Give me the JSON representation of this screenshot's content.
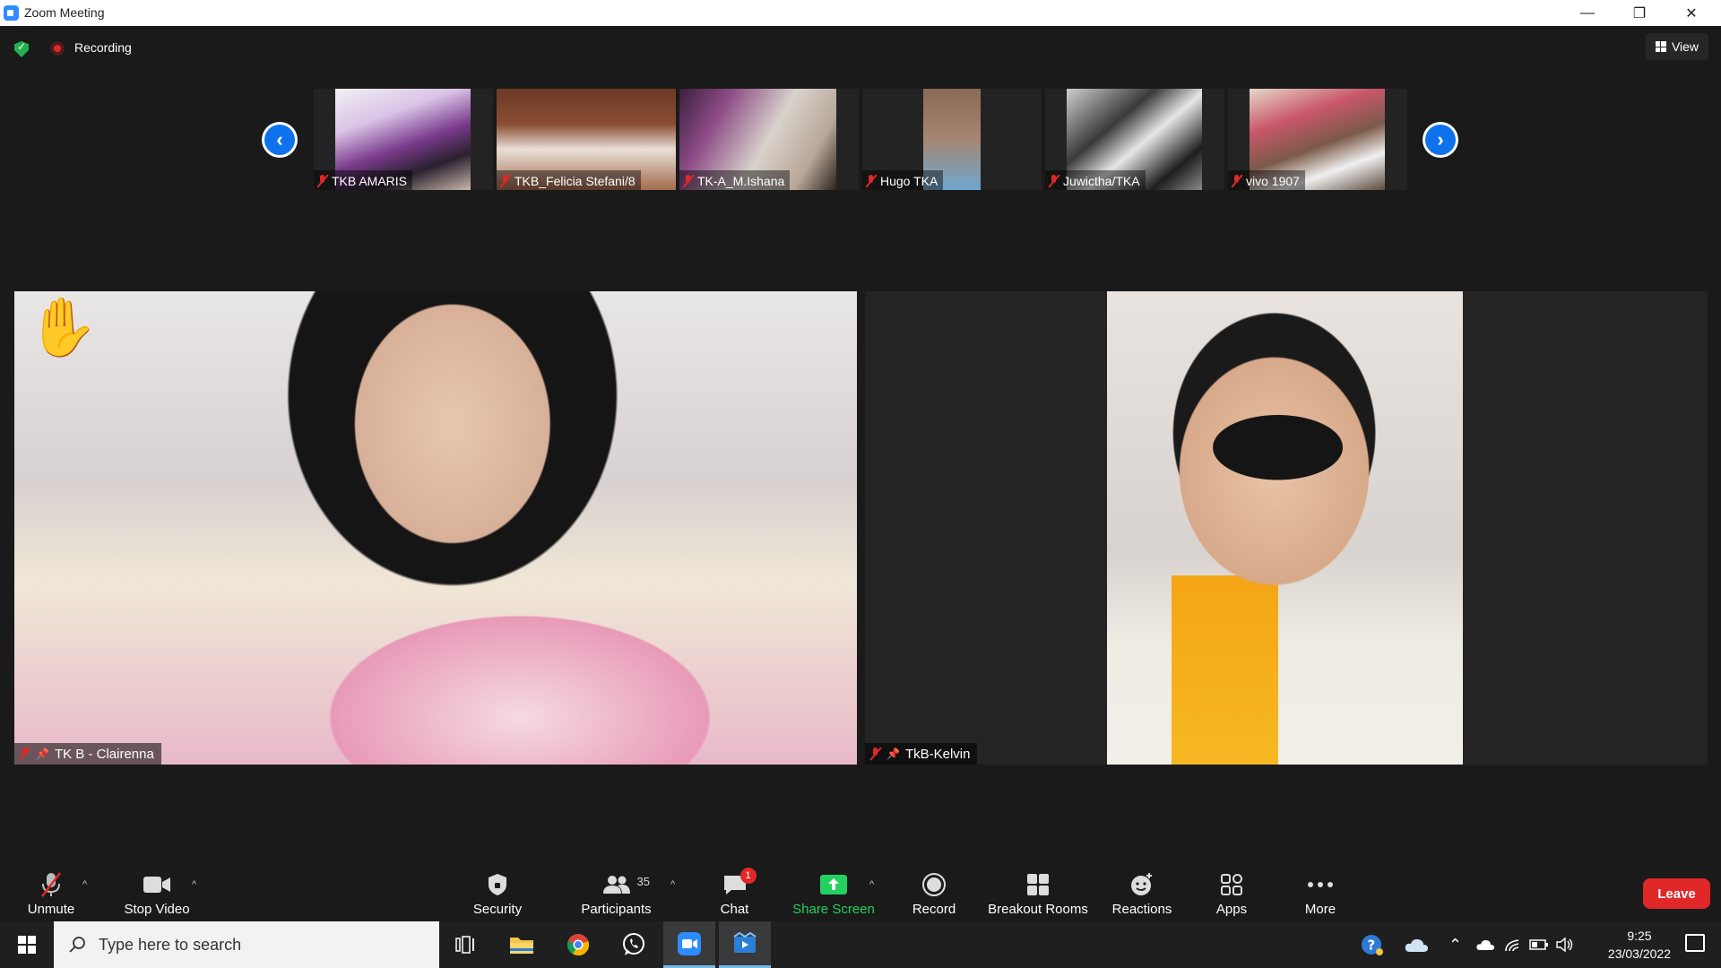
{
  "window": {
    "title": "Zoom Meeting",
    "minimize": "—",
    "restore": "❐",
    "close": "✕"
  },
  "topbar": {
    "recording_label": "Recording",
    "view_label": "View"
  },
  "thumbnails": [
    {
      "name": "TKB AMARIS"
    },
    {
      "name": "TKB_Felicia Stefani/8"
    },
    {
      "name": "TK-A_M.Ishana"
    },
    {
      "name": "Hugo TKA"
    },
    {
      "name": "Juwictha/TKA"
    },
    {
      "name": "vivo 1907"
    }
  ],
  "nav": {
    "prev": "‹",
    "next": "›"
  },
  "tiles": [
    {
      "name": "TK B - Clairenna",
      "hand_raised": "✋"
    },
    {
      "name": "TkB-Kelvin"
    }
  ],
  "toolbar": {
    "unmute": "Unmute",
    "stop_video": "Stop Video",
    "security": "Security",
    "participants": "Participants",
    "participants_count": "35",
    "chat": "Chat",
    "chat_badge": "1",
    "share_screen": "Share Screen",
    "record": "Record",
    "breakout_rooms": "Breakout Rooms",
    "reactions": "Reactions",
    "apps": "Apps",
    "more": "More",
    "leave": "Leave"
  },
  "colors": {
    "accent_green": "#23d160",
    "leave_red": "#e02828",
    "zoom_blue": "#0e72ed"
  },
  "taskbar": {
    "search_placeholder": "Type here to search",
    "time": "9:25",
    "date": "23/03/2022"
  }
}
